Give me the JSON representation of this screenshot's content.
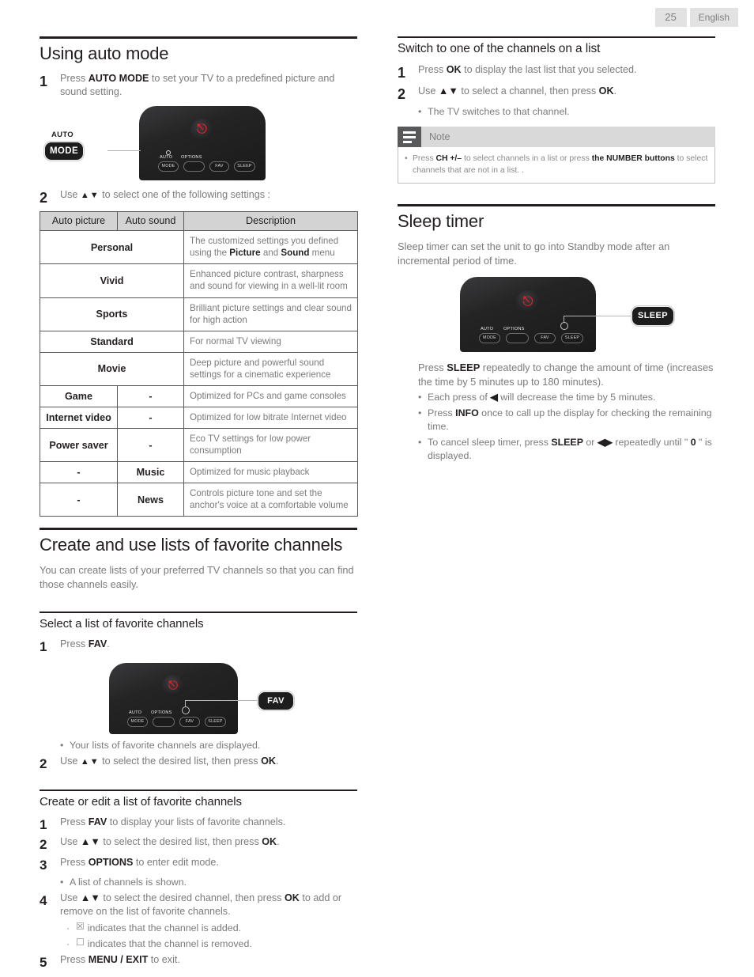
{
  "header": {
    "page_number": "25",
    "language": "English"
  },
  "left": {
    "section1": {
      "title": "Using auto mode",
      "step1_num": "1",
      "step1_pre": "Press ",
      "step1_bold": "AUTO MODE",
      "step1_post": " to set your TV to a predefined picture and sound setting.",
      "remote1": {
        "callout_label_top": "AUTO",
        "callout_label": "MODE",
        "buttons": [
          "MODE",
          "",
          "FAV",
          "SLEEP"
        ],
        "button_labels": [
          "AUTO",
          "OPTIONS",
          "",
          ""
        ]
      },
      "step2_num": "2",
      "step2_pre": "Use ",
      "step2_arrows": "▲▼",
      "step2_post": " to select one of the following settings :",
      "table": {
        "headers": [
          "Auto picture",
          "Auto sound",
          "Description"
        ],
        "rows": [
          {
            "span": true,
            "picture": "Personal",
            "sound": "",
            "desc_parts": [
              {
                "t": "The customized settings you defined using the ",
                "b": false
              },
              {
                "t": "Picture",
                "b": true
              },
              {
                "t": " and ",
                "b": false
              },
              {
                "t": "Sound",
                "b": true
              },
              {
                "t": " menu",
                "b": false
              }
            ]
          },
          {
            "span": true,
            "picture": "Vivid",
            "sound": "",
            "desc_parts": [
              {
                "t": "Enhanced picture contrast, sharpness and sound for viewing in a well-lit room",
                "b": false
              }
            ]
          },
          {
            "span": true,
            "picture": "Sports",
            "sound": "",
            "desc_parts": [
              {
                "t": "Brilliant picture settings and clear sound for high action",
                "b": false
              }
            ]
          },
          {
            "span": true,
            "picture": "Standard",
            "sound": "",
            "desc_parts": [
              {
                "t": "For normal TV viewing",
                "b": false
              }
            ]
          },
          {
            "span": true,
            "picture": "Movie",
            "sound": "",
            "desc_parts": [
              {
                "t": "Deep picture and powerful sound settings for a cinematic experience",
                "b": false
              }
            ]
          },
          {
            "span": false,
            "picture": "Game",
            "sound": "-",
            "desc_parts": [
              {
                "t": "Optimized for PCs and game consoles",
                "b": false
              }
            ]
          },
          {
            "span": false,
            "picture": "Internet video",
            "sound": "-",
            "desc_parts": [
              {
                "t": "Optimized for low bitrate Internet video",
                "b": false
              }
            ]
          },
          {
            "span": false,
            "picture": "Power saver",
            "sound": "-",
            "desc_parts": [
              {
                "t": "Eco TV settings for low power consumption",
                "b": false
              }
            ]
          },
          {
            "span": false,
            "picture": "-",
            "sound": "Music",
            "desc_parts": [
              {
                "t": "Optimized for music playback",
                "b": false
              }
            ]
          },
          {
            "span": false,
            "picture": "-",
            "sound": "News",
            "desc_parts": [
              {
                "t": "Controls picture tone and set the anchor's voice at a comfortable volume",
                "b": false
              }
            ]
          }
        ]
      }
    },
    "section2": {
      "title": "Create and use lists of favorite channels",
      "intro": "You can create lists of your preferred TV channels so that you can find those channels easily.",
      "sub1": {
        "title": "Select a list of favorite channels",
        "step1_num": "1",
        "step1_pre": "Press ",
        "step1_bold": "FAV",
        "step1_post": ".",
        "remote2": {
          "callout_label": "FAV",
          "buttons": [
            "MODE",
            "",
            "FAV",
            "SLEEP"
          ],
          "button_labels": [
            "AUTO",
            "OPTIONS",
            "",
            ""
          ]
        },
        "bullet1": "Your lists of favorite channels are displayed.",
        "step2_num": "2",
        "step2_pre": "Use ",
        "step2_arrows": "▲▼",
        "step2_mid": " to select the desired list, then press ",
        "step2_bold": "OK",
        "step2_post": "."
      },
      "sub2": {
        "title": "Create or edit a list of favorite channels",
        "steps": [
          {
            "num": "1",
            "parts": [
              {
                "t": "Press ",
                "b": false
              },
              {
                "t": "FAV",
                "b": true
              },
              {
                "t": " to display your lists of favorite channels.",
                "b": false
              }
            ]
          },
          {
            "num": "2",
            "parts": [
              {
                "t": "Use ",
                "b": false
              },
              {
                "t": "▲▼",
                "b": true
              },
              {
                "t": " to select the desired list, then press ",
                "b": false
              },
              {
                "t": "OK",
                "b": true
              },
              {
                "t": ".",
                "b": false
              }
            ]
          },
          {
            "num": "3",
            "parts": [
              {
                "t": "Press ",
                "b": false
              },
              {
                "t": "OPTIONS",
                "b": true
              },
              {
                "t": " to enter edit mode.",
                "b": false
              }
            ]
          }
        ],
        "bullet3": "A list of channels is shown.",
        "step4_num": "4",
        "step4_parts": [
          {
            "t": "Use ",
            "b": false
          },
          {
            "t": "▲▼",
            "b": true
          },
          {
            "t": " to select the desired channel, then press ",
            "b": false
          },
          {
            "t": "OK",
            "b": true
          },
          {
            "t": " to add or remove on the list of favorite channels.",
            "b": false
          }
        ],
        "bullet4a_icon": "☒",
        "bullet4a": "indicates that the channel is added.",
        "bullet4b_icon": "☐",
        "bullet4b": "indicates that the channel is removed.",
        "step5_num": "5",
        "step5_parts": [
          {
            "t": "Press ",
            "b": false
          },
          {
            "t": "MENU / EXIT",
            "b": true
          },
          {
            "t": " to exit.",
            "b": false
          }
        ]
      }
    }
  },
  "right": {
    "section1": {
      "title": "Switch to one of the channels on a list",
      "steps": [
        {
          "num": "1",
          "parts": [
            {
              "t": "Press ",
              "b": false
            },
            {
              "t": "OK",
              "b": true
            },
            {
              "t": " to display the last list that you selected.",
              "b": false
            }
          ]
        },
        {
          "num": "2",
          "parts": [
            {
              "t": "Use ",
              "b": false
            },
            {
              "t": "▲▼",
              "b": true
            },
            {
              "t": " to select a channel, then press ",
              "b": false
            },
            {
              "t": "OK",
              "b": true
            },
            {
              "t": ".",
              "b": false
            }
          ]
        }
      ],
      "bullet": "The TV switches to that channel.",
      "note": {
        "title": "Note",
        "parts": [
          {
            "t": "Press ",
            "b": false
          },
          {
            "t": "CH +/–",
            "b": true
          },
          {
            "t": " to select channels in a list or press ",
            "b": false
          },
          {
            "t": "the NUMBER buttons",
            "b": true
          },
          {
            "t": " to select channels that are not in a list. .",
            "b": false
          }
        ]
      }
    },
    "section2": {
      "title": "Sleep timer",
      "intro": "Sleep timer can set the unit to go into Standby mode after an incremental period of time.",
      "remote3": {
        "callout_label": "SLEEP",
        "buttons": [
          "MODE",
          "",
          "FAV",
          "SLEEP"
        ],
        "button_labels": [
          "AUTO",
          "OPTIONS",
          "",
          ""
        ]
      },
      "para_parts": [
        {
          "t": "Press ",
          "b": false
        },
        {
          "t": "SLEEP",
          "b": true
        },
        {
          "t": " repeatedly to change the amount of time (increases the time by 5 minutes up to 180 minutes).",
          "b": false
        }
      ],
      "bullets": [
        [
          {
            "t": "Each press of ",
            "b": false
          },
          {
            "t": "◀",
            "b": true
          },
          {
            "t": " will decrease the time by 5 minutes.",
            "b": false
          }
        ],
        [
          {
            "t": "Press ",
            "b": false
          },
          {
            "t": "INFO",
            "b": true
          },
          {
            "t": " once to call up the display for checking the remaining time.",
            "b": false
          }
        ],
        [
          {
            "t": "To cancel sleep timer, press ",
            "b": false
          },
          {
            "t": "SLEEP",
            "b": true
          },
          {
            "t": " or ",
            "b": false
          },
          {
            "t": "◀▶",
            "b": true
          },
          {
            "t": " repeatedly until \" ",
            "b": false
          },
          {
            "t": "0",
            "b": true
          },
          {
            "t": " \" is displayed.",
            "b": false
          }
        ]
      ]
    }
  },
  "colors": {
    "heading": "#231f20",
    "body": "#7b7b7b",
    "table_header_bg": "#d3d3d3",
    "note_header_bg": "#d9d9d9",
    "note_icon_bg": "#58595b",
    "power_red": "#d8202a",
    "chip_bg": "#e2e2e2"
  }
}
